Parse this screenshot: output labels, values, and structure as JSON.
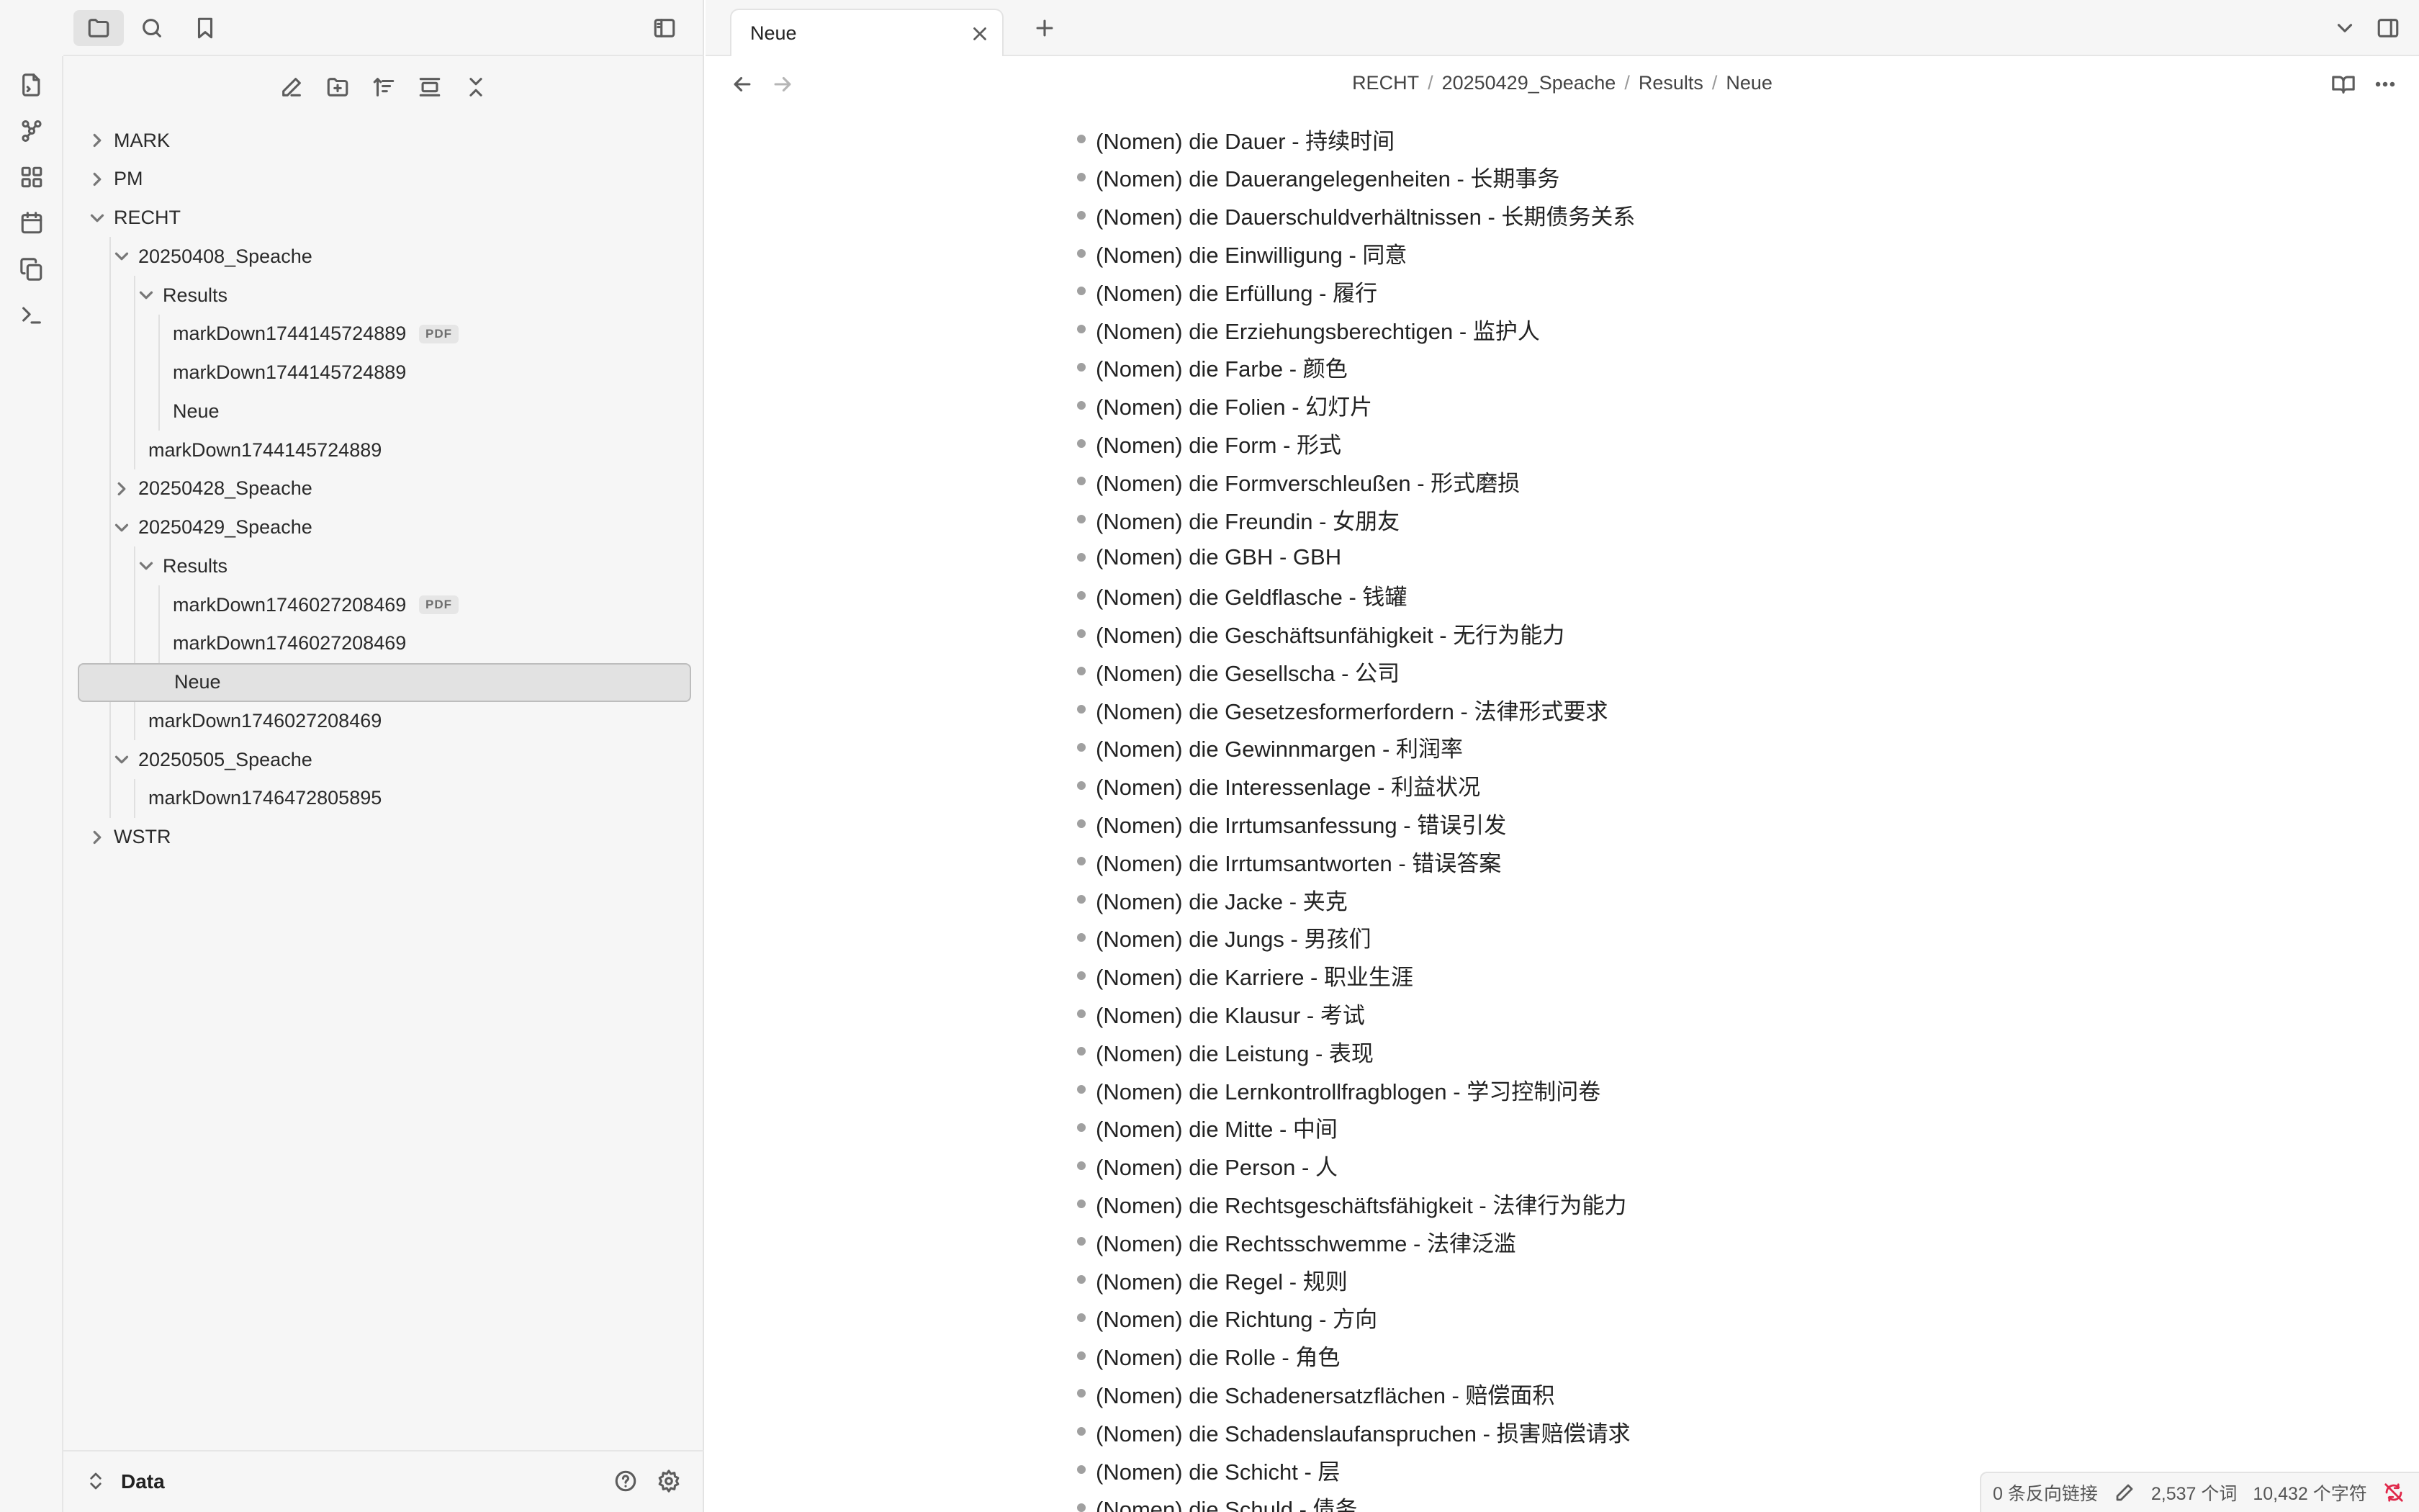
{
  "sidebar": {
    "vault_name": "Data",
    "tree": [
      {
        "label": "MARK",
        "level": 0,
        "state": "collapsed"
      },
      {
        "label": "PM",
        "level": 0,
        "state": "collapsed"
      },
      {
        "label": "RECHT",
        "level": 0,
        "state": "expanded"
      },
      {
        "label": "20250408_Speache",
        "level": 1,
        "state": "expanded"
      },
      {
        "label": "Results",
        "level": 2,
        "state": "expanded"
      },
      {
        "label": "markDown1744145724889",
        "level": 3,
        "state": "file",
        "badge": "PDF"
      },
      {
        "label": "markDown1744145724889",
        "level": 3,
        "state": "file"
      },
      {
        "label": "Neue",
        "level": 3,
        "state": "file"
      },
      {
        "label": "markDown1744145724889",
        "level": 2,
        "state": "file"
      },
      {
        "label": "20250428_Speache",
        "level": 1,
        "state": "collapsed"
      },
      {
        "label": "20250429_Speache",
        "level": 1,
        "state": "expanded"
      },
      {
        "label": "Results",
        "level": 2,
        "state": "expanded"
      },
      {
        "label": "markDown1746027208469",
        "level": 3,
        "state": "file",
        "badge": "PDF"
      },
      {
        "label": "markDown1746027208469",
        "level": 3,
        "state": "file"
      },
      {
        "label": "Neue",
        "level": 3,
        "state": "file",
        "selected": true
      },
      {
        "label": "markDown1746027208469",
        "level": 2,
        "state": "file"
      },
      {
        "label": "20250505_Speache",
        "level": 1,
        "state": "expanded"
      },
      {
        "label": "markDown1746472805895",
        "level": 2,
        "state": "file"
      },
      {
        "label": "WSTR",
        "level": 0,
        "state": "collapsed"
      }
    ]
  },
  "tab": {
    "title": "Neue"
  },
  "breadcrumb": [
    "RECHT",
    "20250429_Speache",
    "Results",
    "Neue"
  ],
  "content": {
    "items": [
      "(Nomen) die Dauer - 持续时间",
      "(Nomen) die Dauerangelegenheiten - 长期事务",
      "(Nomen) die Dauerschuldverhältnissen - 长期债务关系",
      "(Nomen) die Einwilligung - 同意",
      "(Nomen) die Erfüllung - 履行",
      "(Nomen) die Erziehungsberechtigen - 监护人",
      "(Nomen) die Farbe - 颜色",
      "(Nomen) die Folien - 幻灯片",
      "(Nomen) die Form - 形式",
      "(Nomen) die Formverschleußen - 形式磨损",
      "(Nomen) die Freundin - 女朋友",
      "(Nomen) die GBH - GBH",
      "(Nomen) die Geldflasche - 钱罐",
      "(Nomen) die Geschäftsunfähigkeit - 无行为能力",
      "(Nomen) die Gesellscha - 公司",
      "(Nomen) die Gesetzesformerfordern - 法律形式要求",
      "(Nomen) die Gewinnmargen - 利润率",
      "(Nomen) die Interessenlage - 利益状况",
      "(Nomen) die Irrtumsanfessung - 错误引发",
      "(Nomen) die Irrtumsantworten - 错误答案",
      "(Nomen) die Jacke - 夹克",
      "(Nomen) die Jungs - 男孩们",
      "(Nomen) die Karriere - 职业生涯",
      "(Nomen) die Klausur - 考试",
      "(Nomen) die Leistung - 表现",
      "(Nomen) die Lernkontrollfragblogen - 学习控制问卷",
      "(Nomen) die Mitte - 中间",
      "(Nomen) die Person - 人",
      "(Nomen) die Rechtsgeschäftsfähigkeit - 法律行为能力",
      "(Nomen) die Rechtsschwemme - 法律泛滥",
      "(Nomen) die Regel - 规则",
      "(Nomen) die Richtung - 方向",
      "(Nomen) die Rolle - 角色",
      "(Nomen) die Schadenersatzflächen - 赔偿面积",
      "(Nomen) die Schadenslaufanspruchen - 损害赔偿请求",
      "(Nomen) die Schicht - 层",
      "(Nomen) die Schuld - 债务"
    ]
  },
  "status_bar": {
    "backlinks": "0 条反向链接",
    "words": "2,537 个词",
    "chars": "10,432 个字符"
  },
  "colors": {
    "sync_error": "#e0284a",
    "selected_bg": "#e2e2e2"
  }
}
